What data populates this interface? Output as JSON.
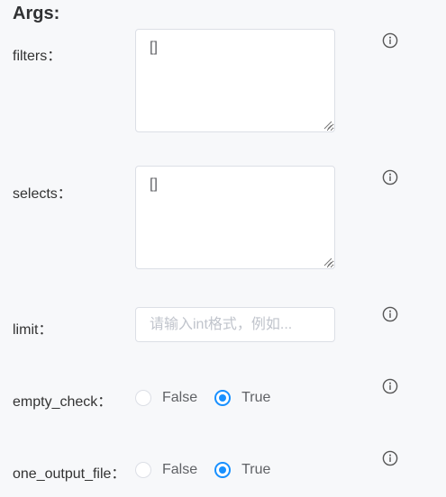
{
  "section": {
    "title": "Args:"
  },
  "fields": {
    "filters": {
      "label": "filters：",
      "value": "[]"
    },
    "selects": {
      "label": "selects：",
      "value": "[]"
    },
    "limit": {
      "label": "limit：",
      "value": "",
      "placeholder": "请输入int格式，例如..."
    },
    "empty_check": {
      "label": "empty_check：",
      "options": [
        "False",
        "True"
      ],
      "selected": "True"
    },
    "one_output_file": {
      "label": "one_output_file：",
      "options": [
        "False",
        "True"
      ],
      "selected": "True"
    }
  },
  "icons": {
    "info": "info-circle-icon",
    "resize": "resize-grip-icon"
  },
  "colors": {
    "accent": "#1890ff",
    "border": "#dcdfe6",
    "background": "#f7f8fa",
    "icon": "#555555"
  }
}
